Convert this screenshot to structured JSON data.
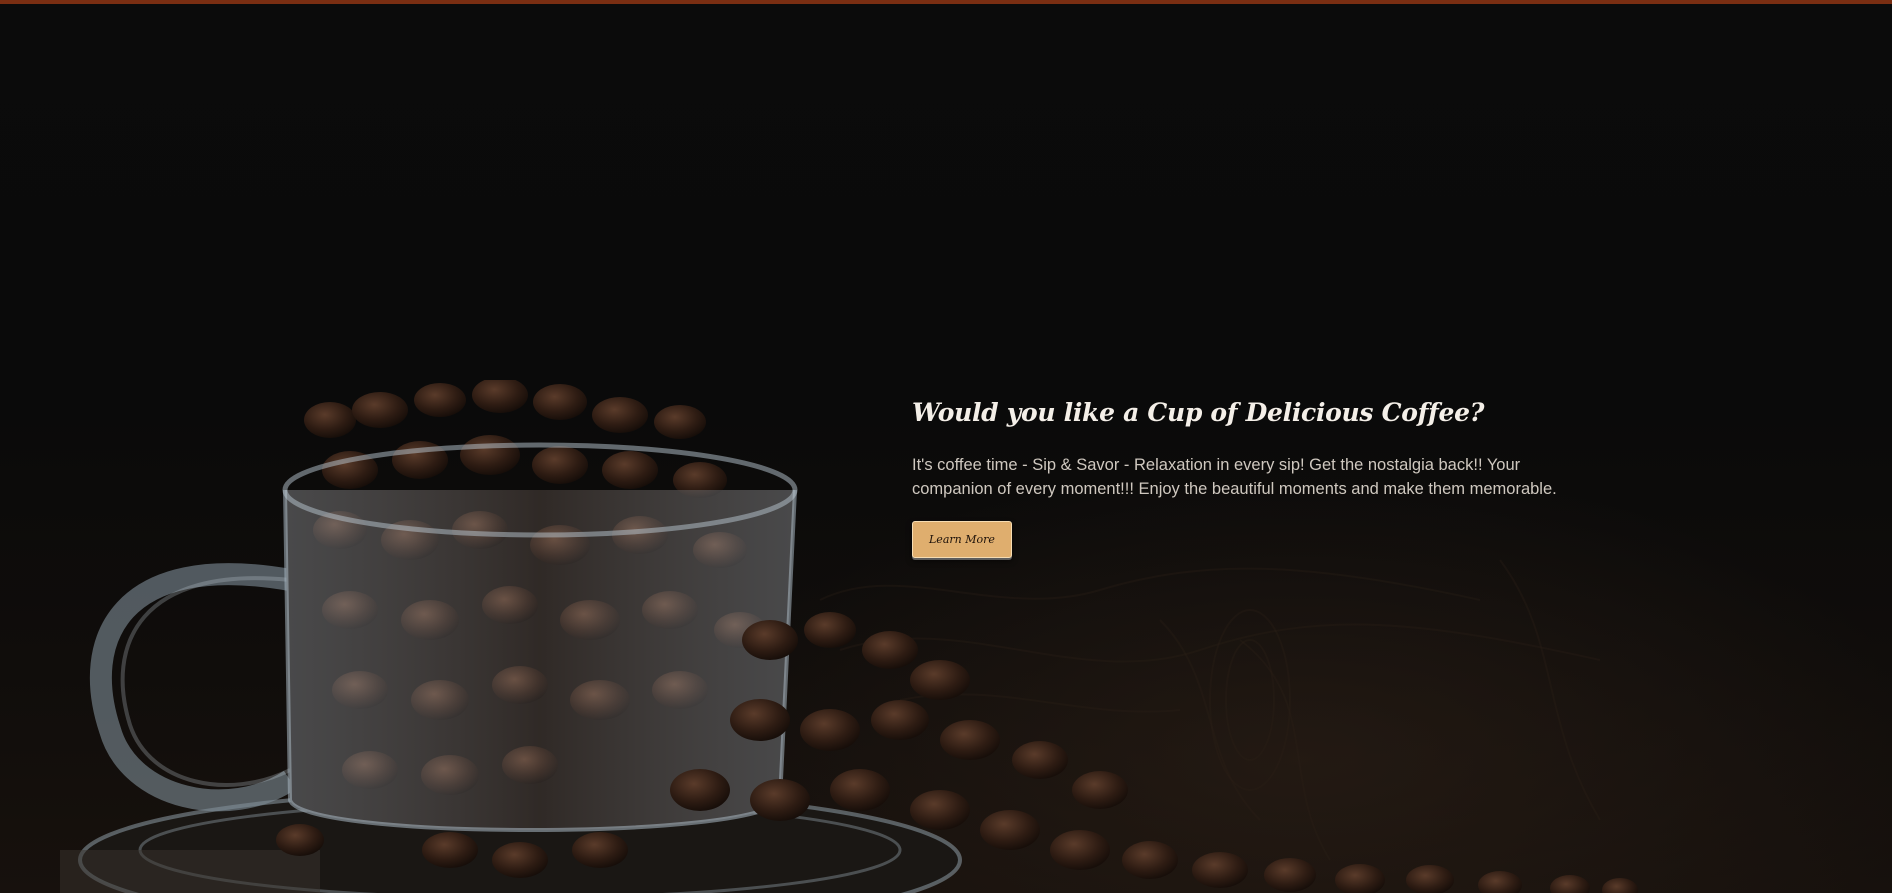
{
  "theme": {
    "accent_bar_color": "#7a2e12",
    "button_color": "#dfae6e"
  },
  "hero": {
    "headline": "Would you like a Cup of Delicious Coffee?",
    "description": "It's coffee time - Sip & Savor - Relaxation in every sip! Get the nostalgia back!! Your companion of every moment!!! Enjoy the beautiful moments and make them memorable.",
    "cta_label": "Learn More"
  }
}
